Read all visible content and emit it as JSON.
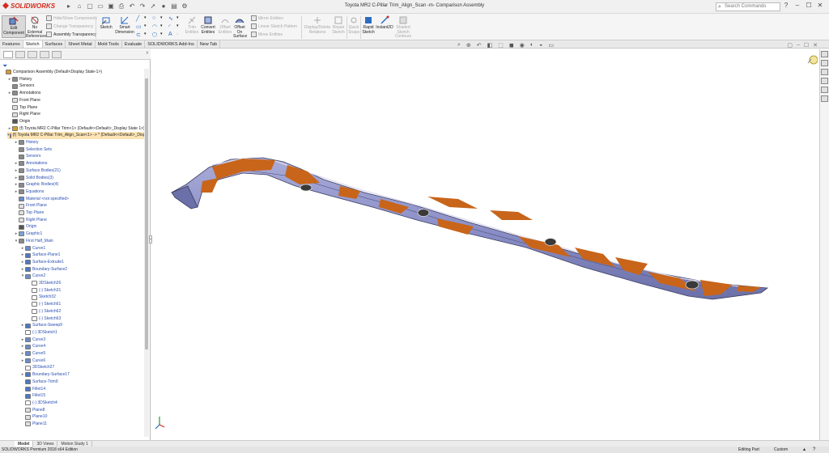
{
  "app": {
    "logo": "SOLIDWORKS",
    "title": "Toyota MR2 C-Pillar Trim_Align_Scan -m- Comparison Assembly"
  },
  "search": {
    "placeholder": "Search Commands"
  },
  "ribbon": {
    "edit_component": "Edit\nComponent",
    "no_external_references": "No\nExternal\nReferences",
    "hide_show_components": "Hide/Show Components",
    "change_transparency": "Change Transparency",
    "assembly_transparency": "Assembly Transparency",
    "sketch": "Sketch",
    "smart_dimension": "Smart\nDimension",
    "trim_entities": "Trim\nEntities",
    "convert_entities": "Convert\nEntities",
    "offset_entities": "Offset\nEntities",
    "offset_on_surface": "Offset\nOn\nSurface",
    "mirror_entities": "Mirror Entities",
    "linear_sketch_pattern": "Linear Sketch Pattern",
    "move_entities": "Move Entities",
    "display_delete_relations": "Display/Delete\nRelations",
    "repair_sketch": "Repair\nSketch",
    "quick_snaps": "Quick\nSnaps",
    "rapid_sketch": "Rapid\nSketch",
    "instant2d": "Instant2D",
    "shaded_sketch_contours": "Shaded\nSketch\nContours"
  },
  "tabs": [
    "Features",
    "Sketch",
    "Surfaces",
    "Sheet Metal",
    "Mold Tools",
    "Evaluate",
    "SOLIDWORKS Add-Ins",
    "New Tab"
  ],
  "active_tab": "Sketch",
  "tree": [
    {
      "label": "Comparison Assembly  (Default<Display State-1>)",
      "indent": 0,
      "toggle": "",
      "icon": "assembly",
      "blue": false
    },
    {
      "label": "History",
      "indent": 1,
      "toggle": "▸",
      "icon": "folder",
      "blue": false
    },
    {
      "label": "Sensors",
      "indent": 1,
      "toggle": "",
      "icon": "folder",
      "blue": false
    },
    {
      "label": "Annotations",
      "indent": 1,
      "toggle": "▸",
      "icon": "folder",
      "blue": false
    },
    {
      "label": "Front Plane",
      "indent": 1,
      "toggle": "",
      "icon": "plane",
      "blue": false
    },
    {
      "label": "Top Plane",
      "indent": 1,
      "toggle": "",
      "icon": "plane",
      "blue": false
    },
    {
      "label": "Right Plane",
      "indent": 1,
      "toggle": "",
      "icon": "plane",
      "blue": false
    },
    {
      "label": "Origin",
      "indent": 1,
      "toggle": "",
      "icon": "origin",
      "blue": false
    },
    {
      "label": "(f) Toyota MR2 C-Pillar Trim<1> (Default<<Default>_Display State 1>)",
      "indent": 1,
      "toggle": "▸",
      "icon": "part",
      "blue": false
    },
    {
      "label": "(f) Toyota MR2 C-Pillar Trim_Align_Scan<1> -> * (Default<<Default>_Displ",
      "indent": 1,
      "toggle": "▾",
      "icon": "part",
      "blue": false,
      "selected": true
    },
    {
      "label": "History",
      "indent": 2,
      "toggle": "▸",
      "icon": "folder",
      "blue": true
    },
    {
      "label": "Selection Sets",
      "indent": 2,
      "toggle": "",
      "icon": "folder",
      "blue": true
    },
    {
      "label": "Sensors",
      "indent": 2,
      "toggle": "",
      "icon": "folder",
      "blue": true
    },
    {
      "label": "Annotations",
      "indent": 2,
      "toggle": "▸",
      "icon": "folder",
      "blue": true
    },
    {
      "label": "Surface Bodies(21)",
      "indent": 2,
      "toggle": "▸",
      "icon": "folder",
      "blue": true
    },
    {
      "label": "Solid Bodies(3)",
      "indent": 2,
      "toggle": "▸",
      "icon": "folder",
      "blue": true
    },
    {
      "label": "Graphic Bodies(4)",
      "indent": 2,
      "toggle": "▸",
      "icon": "folder",
      "blue": true
    },
    {
      "label": "Equations",
      "indent": 2,
      "toggle": "▸",
      "icon": "folder",
      "blue": true
    },
    {
      "label": "Material <not specified>",
      "indent": 2,
      "toggle": "",
      "icon": "material",
      "blue": true
    },
    {
      "label": "Front Plane",
      "indent": 2,
      "toggle": "",
      "icon": "plane",
      "blue": true
    },
    {
      "label": "Top Plane",
      "indent": 2,
      "toggle": "",
      "icon": "plane",
      "blue": true
    },
    {
      "label": "Right Plane",
      "indent": 2,
      "toggle": "",
      "icon": "plane",
      "blue": true
    },
    {
      "label": "Origin",
      "indent": 2,
      "toggle": "",
      "icon": "origin",
      "blue": true
    },
    {
      "label": "Graphic1",
      "indent": 2,
      "toggle": "▸",
      "icon": "graphic",
      "blue": true
    },
    {
      "label": "First Half_Main",
      "indent": 2,
      "toggle": "▾",
      "icon": "folder",
      "blue": true
    },
    {
      "label": "Curve1",
      "indent": 3,
      "toggle": "▸",
      "icon": "curve",
      "blue": true
    },
    {
      "label": "Surface-Plane1",
      "indent": 3,
      "toggle": "▸",
      "icon": "surface",
      "blue": true
    },
    {
      "label": "Surface-Extrude1",
      "indent": 3,
      "toggle": "▸",
      "icon": "surface",
      "blue": true
    },
    {
      "label": "Boundary-Surface2",
      "indent": 3,
      "toggle": "▸",
      "icon": "surface",
      "blue": true
    },
    {
      "label": "Curve2",
      "indent": 3,
      "toggle": "▾",
      "icon": "curve",
      "blue": true
    },
    {
      "label": "3DSketch26",
      "indent": 4,
      "toggle": "",
      "icon": "sketch",
      "blue": true
    },
    {
      "label": "(-) Sketch31",
      "indent": 4,
      "toggle": "",
      "icon": "sketch",
      "blue": true
    },
    {
      "label": "Sketch32",
      "indent": 4,
      "toggle": "",
      "icon": "sketch",
      "blue": true
    },
    {
      "label": "(-) Sketch61",
      "indent": 4,
      "toggle": "",
      "icon": "sketch",
      "blue": true
    },
    {
      "label": "(-) Sketch62",
      "indent": 4,
      "toggle": "",
      "icon": "sketch",
      "blue": true
    },
    {
      "label": "(-) Sketch63",
      "indent": 4,
      "toggle": "",
      "icon": "sketch",
      "blue": true
    },
    {
      "label": "Surface-Sweep9",
      "indent": 3,
      "toggle": "▸",
      "icon": "surface",
      "blue": true
    },
    {
      "label": "(-) 3DSketch1",
      "indent": 3,
      "toggle": "",
      "icon": "sketch",
      "blue": true
    },
    {
      "label": "Curve3",
      "indent": 3,
      "toggle": "▸",
      "icon": "curve",
      "blue": true
    },
    {
      "label": "Curve4",
      "indent": 3,
      "toggle": "▸",
      "icon": "curve",
      "blue": true
    },
    {
      "label": "Curve5",
      "indent": 3,
      "toggle": "▸",
      "icon": "curve",
      "blue": true
    },
    {
      "label": "Curve6",
      "indent": 3,
      "toggle": "▸",
      "icon": "curve",
      "blue": true
    },
    {
      "label": "3DSketch27",
      "indent": 3,
      "toggle": "",
      "icon": "sketch",
      "blue": true
    },
    {
      "label": "Boundary-Surface17",
      "indent": 3,
      "toggle": "▸",
      "icon": "surface",
      "blue": true
    },
    {
      "label": "Surface-Trim9",
      "indent": 3,
      "toggle": "",
      "icon": "surface",
      "blue": true
    },
    {
      "label": "Fillet14",
      "indent": 3,
      "toggle": "",
      "icon": "surface",
      "blue": true
    },
    {
      "label": "Fillet15",
      "indent": 3,
      "toggle": "",
      "icon": "surface",
      "blue": true
    },
    {
      "label": "(-) 3DSketch4",
      "indent": 3,
      "toggle": "",
      "icon": "sketch",
      "blue": true
    },
    {
      "label": "Plane8",
      "indent": 3,
      "toggle": "",
      "icon": "plane",
      "blue": true
    },
    {
      "label": "Plane10",
      "indent": 3,
      "toggle": "",
      "icon": "plane",
      "blue": true
    },
    {
      "label": "Plane11",
      "indent": 3,
      "toggle": "",
      "icon": "plane",
      "blue": true
    }
  ],
  "bottom_tabs": [
    "Model",
    "3D Views",
    "Motion Study 1"
  ],
  "active_bottom_tab": "Model",
  "status": {
    "left": "SOLIDWORKS Premium 2018 x64 Edition",
    "mode": "Editing Part",
    "units": "Custom"
  },
  "colors": {
    "orange": "#c8651a",
    "lavender": "#8b8fc7",
    "accent_red": "#d52b1e"
  }
}
